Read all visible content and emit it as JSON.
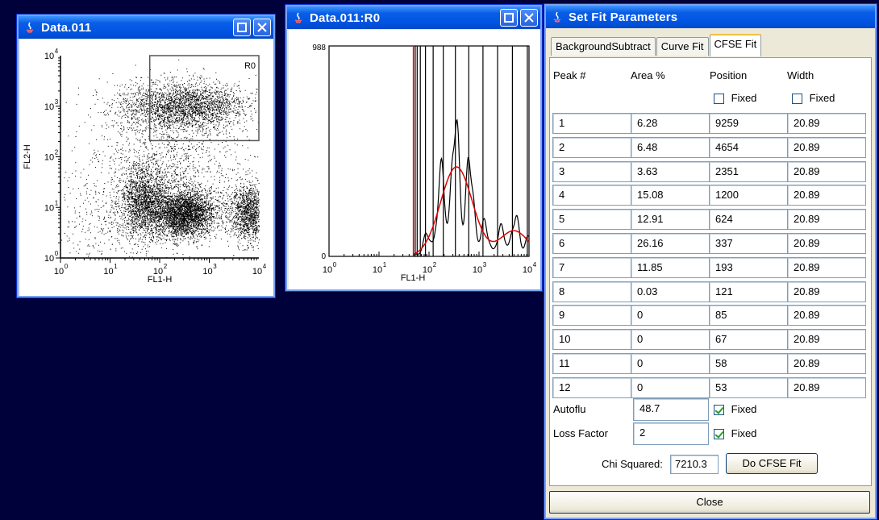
{
  "windows": {
    "dot_plot": {
      "title": "Data.011",
      "x_label": "FL1-H",
      "y_label": "FL2-H",
      "region_label": "R0",
      "x_ticks": [
        "10",
        "10",
        "10",
        "10",
        "10"
      ],
      "x_exps": [
        "0",
        "1",
        "2",
        "3",
        "4"
      ],
      "y_ticks": [
        "10",
        "10",
        "10",
        "10",
        "10"
      ],
      "y_exps": [
        "0",
        "1",
        "2",
        "3",
        "4"
      ]
    },
    "histogram": {
      "title": "Data.011:R0",
      "x_label": "FL1-H",
      "y_max_label": "988",
      "y_min_label": "0",
      "x_ticks": [
        "10",
        "10",
        "10",
        "10",
        "10"
      ],
      "x_exps": [
        "0",
        "1",
        "2",
        "3",
        "4"
      ]
    },
    "fit": {
      "title": "Set Fit Parameters",
      "tabs": [
        "BackgroundSubtract",
        "Curve Fit",
        "CFSE Fit"
      ],
      "active_tab": "CFSE Fit",
      "headers": {
        "peak": "Peak #",
        "area": "Area %",
        "position": "Position",
        "width": "Width"
      },
      "fixed_label": "Fixed",
      "rows": [
        {
          "peak": "1",
          "area": "6.28",
          "position": "9259",
          "width": "20.89"
        },
        {
          "peak": "2",
          "area": "6.48",
          "position": "4654",
          "width": "20.89"
        },
        {
          "peak": "3",
          "area": "3.63",
          "position": "2351",
          "width": "20.89"
        },
        {
          "peak": "4",
          "area": "15.08",
          "position": "1200",
          "width": "20.89"
        },
        {
          "peak": "5",
          "area": "12.91",
          "position": "624",
          "width": "20.89"
        },
        {
          "peak": "6",
          "area": "26.16",
          "position": "337",
          "width": "20.89"
        },
        {
          "peak": "7",
          "area": "11.85",
          "position": "193",
          "width": "20.89"
        },
        {
          "peak": "8",
          "area": "0.03",
          "position": "121",
          "width": "20.89"
        },
        {
          "peak": "9",
          "area": "0",
          "position": "85",
          "width": "20.89"
        },
        {
          "peak": "10",
          "area": "0",
          "position": "67",
          "width": "20.89"
        },
        {
          "peak": "11",
          "area": "0",
          "position": "58",
          "width": "20.89"
        },
        {
          "peak": "12",
          "area": "0",
          "position": "53",
          "width": "20.89"
        }
      ],
      "autoflu_label": "Autoflu",
      "autoflu_value": "48.7",
      "loss_label": "Loss Factor",
      "loss_value": "2",
      "chi_label": "Chi Squared:",
      "chi_value": "7210.3",
      "do_fit_label": "Do CFSE Fit",
      "close_label": "Close"
    }
  },
  "colors": {
    "desktop": "#00003a",
    "title_blue": "#0054e3",
    "fit_curve": "#e00000",
    "gate": "#555555"
  }
}
